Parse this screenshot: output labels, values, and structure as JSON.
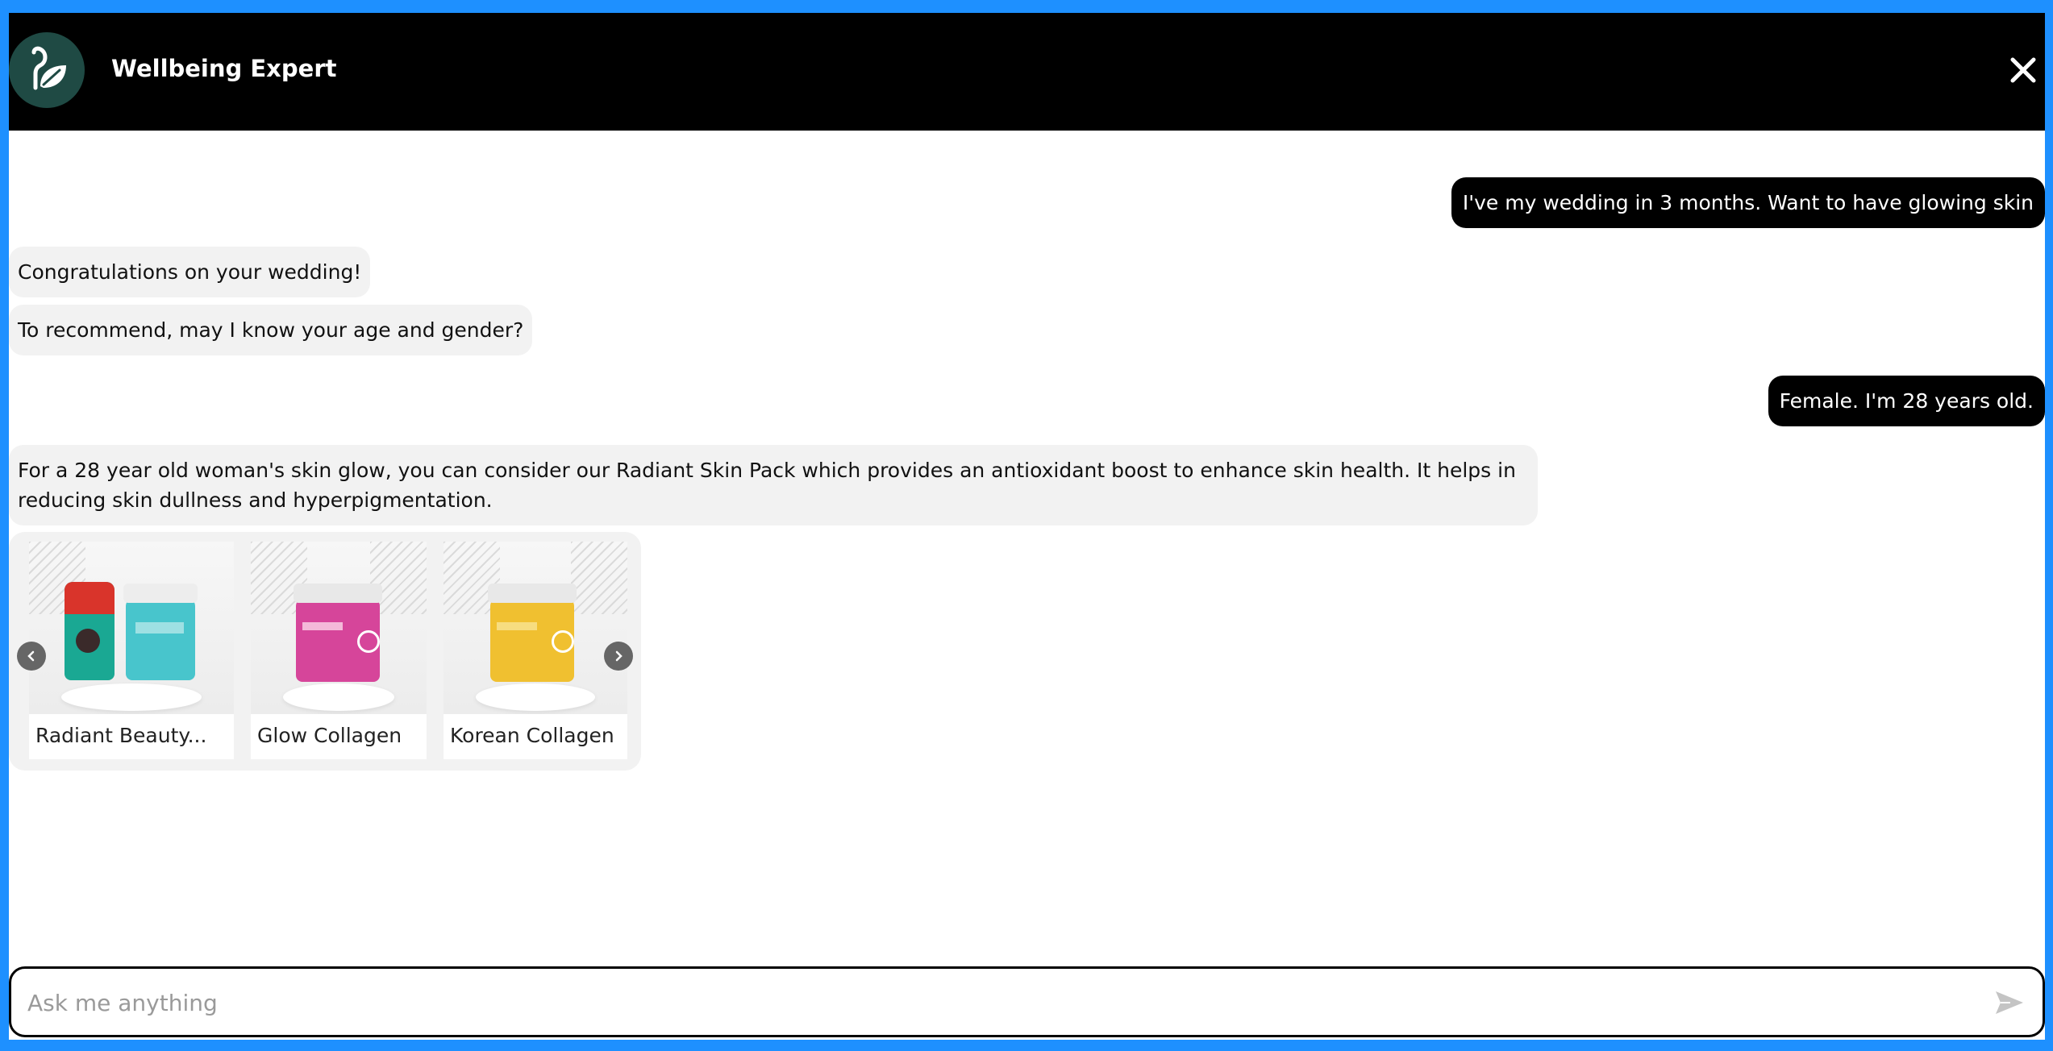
{
  "header": {
    "title": "Wellbeing Expert",
    "logo_icon": "leaf-logo-icon",
    "close_icon": "close-icon"
  },
  "messages": [
    {
      "role": "user",
      "text": "I've my wedding in 3 months. Want to have glowing skin"
    },
    {
      "role": "bot",
      "text": "Congratulations on your wedding!"
    },
    {
      "role": "bot",
      "text": "To recommend, may I know your age and gender?"
    },
    {
      "role": "user",
      "text": "Female. I'm 28 years old."
    },
    {
      "role": "bot",
      "text": "For a 28 year old woman's skin glow, you can consider our Radiant Skin Pack which provides an antioxidant boost to enhance skin health. It helps in reducing skin dullness and hyperpigmentation."
    }
  ],
  "products": [
    {
      "name": "Radiant Beauty..."
    },
    {
      "name": "Glow Collagen"
    },
    {
      "name": "Korean Collagen"
    }
  ],
  "input": {
    "placeholder": "Ask me anything",
    "value": ""
  },
  "colors": {
    "frame": "#1e90ff",
    "header_bg": "#000000",
    "user_bubble": "#000000",
    "bot_bubble": "#f2f2f2"
  }
}
